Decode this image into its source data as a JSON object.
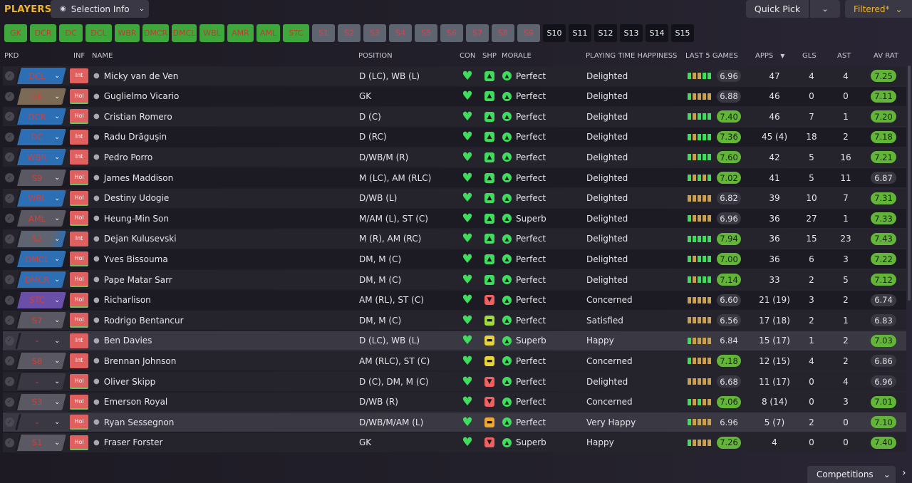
{
  "header": {
    "title": "PLAYERS",
    "selection_info": "Selection Info",
    "quick_pick": "Quick Pick",
    "filtered": "Filtered*"
  },
  "chips": [
    {
      "label": "GK",
      "style": "g",
      "w": 32
    },
    {
      "label": "DCR",
      "style": "g",
      "w": 37
    },
    {
      "label": "DC",
      "style": "g",
      "w": 33
    },
    {
      "label": "DCL",
      "style": "g",
      "w": 37
    },
    {
      "label": "WBR",
      "style": "g",
      "w": 35
    },
    {
      "label": "DMCR",
      "style": "g",
      "w": 37
    },
    {
      "label": "DMCL",
      "style": "g",
      "w": 35
    },
    {
      "label": "WBL",
      "style": "g",
      "w": 35
    },
    {
      "label": "AMR",
      "style": "g",
      "w": 37
    },
    {
      "label": "AML",
      "style": "g",
      "w": 33
    },
    {
      "label": "STC",
      "style": "g",
      "w": 37
    },
    {
      "label": "S1",
      "style": "s",
      "w": 32
    },
    {
      "label": "S2",
      "style": "s",
      "w": 32
    },
    {
      "label": "S3",
      "style": "s",
      "w": 32
    },
    {
      "label": "S4",
      "style": "s",
      "w": 32
    },
    {
      "label": "S5",
      "style": "s",
      "w": 32
    },
    {
      "label": "S6",
      "style": "s",
      "w": 32
    },
    {
      "label": "S7",
      "style": "s",
      "w": 32
    },
    {
      "label": "S8",
      "style": "s",
      "w": 32
    },
    {
      "label": "S9",
      "style": "s",
      "w": 32
    },
    {
      "label": "S10",
      "style": "d",
      "w": 32
    },
    {
      "label": "S11",
      "style": "d",
      "w": 32
    },
    {
      "label": "S12",
      "style": "d",
      "w": 32
    },
    {
      "label": "S13",
      "style": "d",
      "w": 32
    },
    {
      "label": "S14",
      "style": "d",
      "w": 32
    },
    {
      "label": "S15",
      "style": "d",
      "w": 32
    }
  ],
  "columns": {
    "pkd": "PKD",
    "inf": "INF",
    "name": "NAME",
    "position": "POSITION",
    "con": "CON",
    "shp": "SHP",
    "morale": "MORALE",
    "pth": "PLAYING TIME HAPPINESS",
    "last5": "LAST 5 GAMES",
    "apps": "APPS",
    "gls": "GLS",
    "ast": "AST",
    "avrat": "AV RAT"
  },
  "colors": {
    "accent": "#f0b429",
    "chip_green": "#3fa83c",
    "good": "#3fdc5e",
    "bad": "#d2403a"
  },
  "players": [
    {
      "pos": "DCL",
      "posStyle": "blue",
      "inf": "Int",
      "name": "Micky van de Ven",
      "position": "D (LC), WB (L)",
      "shp": "green",
      "morale": "Perfect",
      "pth": "Delighted",
      "bars": "gttgg",
      "last5rating": "6.96",
      "l5green": false,
      "apps": "47",
      "gls": "4",
      "ast": "4",
      "avrat": "7.25",
      "avgreen": true
    },
    {
      "pos": "GK",
      "posStyle": "brown",
      "inf": "Hol",
      "name": "Guglielmo Vicario",
      "position": "GK",
      "shp": "green",
      "morale": "Perfect",
      "pth": "Delighted",
      "bars": "gtttt",
      "last5rating": "6.88",
      "l5green": false,
      "apps": "46",
      "gls": "0",
      "ast": "0",
      "avrat": "7.11",
      "avgreen": true
    },
    {
      "pos": "DCR",
      "posStyle": "blue",
      "inf": "Hol",
      "name": "Cristian Romero",
      "position": "D (C)",
      "shp": "green",
      "morale": "Perfect",
      "pth": "Delighted",
      "bars": "gtggg",
      "last5rating": "7.40",
      "l5green": true,
      "apps": "46",
      "gls": "7",
      "ast": "1",
      "avrat": "7.20",
      "avgreen": true
    },
    {
      "pos": "DC",
      "posStyle": "blue",
      "inf": "Int",
      "name": "Radu Drăgușin",
      "position": "D (RC)",
      "shp": "green",
      "morale": "Perfect",
      "pth": "Delighted",
      "bars": "gtggg",
      "last5rating": "7.36",
      "l5green": true,
      "apps": "45 (4)",
      "gls": "18",
      "ast": "2",
      "avrat": "7.18",
      "avgreen": true
    },
    {
      "pos": "WBR",
      "posStyle": "blue",
      "inf": "Int",
      "name": "Pedro Porro",
      "position": "D/WB/M (R)",
      "shp": "green",
      "morale": "Perfect",
      "pth": "Delighted",
      "bars": "gtggg",
      "last5rating": "7.60",
      "l5green": true,
      "apps": "42",
      "gls": "5",
      "ast": "16",
      "avrat": "7.21",
      "avgreen": true
    },
    {
      "pos": "S9",
      "posStyle": "grey",
      "inf": "Hol",
      "name": "James Maddison",
      "position": "M (LC), AM (RLC)",
      "shp": "green",
      "morale": "Perfect",
      "pth": "Delighted",
      "bars": "gtgtg",
      "last5rating": "7.02",
      "l5green": true,
      "apps": "41",
      "gls": "5",
      "ast": "11",
      "avrat": "6.87",
      "avgreen": false
    },
    {
      "pos": "WBL",
      "posStyle": "blue",
      "inf": "Hol",
      "name": "Destiny Udogie",
      "position": "D/WB (L)",
      "shp": "green",
      "morale": "Perfect",
      "pth": "Delighted",
      "bars": "ttttt",
      "last5rating": "6.82",
      "l5green": false,
      "apps": "39",
      "gls": "10",
      "ast": "7",
      "avrat": "7.31",
      "avgreen": true
    },
    {
      "pos": "AML",
      "posStyle": "grey",
      "inf": "Hol",
      "name": "Heung-Min Son",
      "position": "M/AM (L), ST (C)",
      "shp": "green",
      "morale": "Superb",
      "pth": "Delighted",
      "bars": "gtttt",
      "last5rating": "6.96",
      "l5green": false,
      "apps": "36",
      "gls": "27",
      "ast": "1",
      "avrat": "7.33",
      "avgreen": true
    },
    {
      "pos": "S2",
      "posStyle": "gb",
      "inf": "Int",
      "name": "Dejan Kulusevski",
      "position": "M (R), AM (RC)",
      "shp": "green",
      "morale": "Perfect",
      "pth": "Delighted",
      "bars": "ggggg",
      "last5rating": "7.94",
      "l5green": true,
      "apps": "36",
      "gls": "15",
      "ast": "23",
      "avrat": "7.43",
      "avgreen": true
    },
    {
      "pos": "DMCL",
      "posStyle": "blue",
      "inf": "Hol",
      "name": "Yves Bissouma",
      "position": "DM, M (C)",
      "shp": "green",
      "morale": "Perfect",
      "pth": "Delighted",
      "bars": "gtggg",
      "last5rating": "7.00",
      "l5green": true,
      "apps": "36",
      "gls": "6",
      "ast": "3",
      "avrat": "7.22",
      "avgreen": true
    },
    {
      "pos": "DMCR",
      "posStyle": "blue",
      "inf": "Hol",
      "name": "Pape Matar Sarr",
      "position": "DM, M (C)",
      "shp": "green",
      "morale": "Perfect",
      "pth": "Delighted",
      "bars": "gtggg",
      "last5rating": "7.14",
      "l5green": true,
      "apps": "33",
      "gls": "2",
      "ast": "5",
      "avrat": "7.12",
      "avgreen": true
    },
    {
      "pos": "STC",
      "posStyle": "purple",
      "inf": "Hol",
      "name": "Richarlison",
      "position": "AM (RL), ST (C)",
      "shp": "red",
      "morale": "Perfect",
      "pth": "Concerned",
      "bars": "ttttt",
      "last5rating": "6.60",
      "l5green": false,
      "apps": "21 (19)",
      "gls": "3",
      "ast": "2",
      "avrat": "6.74",
      "avgreen": false
    },
    {
      "pos": "S7",
      "posStyle": "grey",
      "inf": "Hol",
      "name": "Rodrigo Bentancur",
      "position": "DM, M (C)",
      "shp": "lime",
      "morale": "Perfect",
      "pth": "Satisfied",
      "bars": "ttttt",
      "last5rating": "6.56",
      "l5green": false,
      "apps": "17 (18)",
      "gls": "2",
      "ast": "1",
      "avrat": "6.83",
      "avgreen": false
    },
    {
      "pos": "-",
      "posStyle": "dark",
      "inf": "Int",
      "name": "Ben Davies",
      "position": "D (LC), WB (L)",
      "shp": "yellow",
      "morale": "Superb",
      "pth": "Happy",
      "bars": "gtttt",
      "last5rating": "6.84",
      "l5green": false,
      "apps": "15 (17)",
      "gls": "1",
      "ast": "2",
      "avrat": "7.03",
      "avgreen": true
    },
    {
      "pos": "S8",
      "posStyle": "grey",
      "inf": "Int",
      "name": "Brennan Johnson",
      "position": "AM (RLC), ST (C)",
      "shp": "yellow",
      "morale": "Perfect",
      "pth": "Concerned",
      "bars": "gtttt",
      "last5rating": "7.18",
      "l5green": true,
      "apps": "12 (15)",
      "gls": "4",
      "ast": "2",
      "avrat": "6.86",
      "avgreen": false
    },
    {
      "pos": "-",
      "posStyle": "dark",
      "inf": "Hol",
      "name": "Oliver Skipp",
      "position": "D (C), DM, M (C)",
      "shp": "red",
      "morale": "Perfect",
      "pth": "Delighted",
      "bars": "ttttt",
      "last5rating": "6.68",
      "l5green": false,
      "apps": "11 (17)",
      "gls": "0",
      "ast": "4",
      "avrat": "6.96",
      "avgreen": false
    },
    {
      "pos": "S3",
      "posStyle": "grey",
      "inf": "Hol",
      "name": "Emerson Royal",
      "position": "D/WB (R)",
      "shp": "red",
      "morale": "Perfect",
      "pth": "Concerned",
      "bars": "gtgtt",
      "last5rating": "7.06",
      "l5green": true,
      "apps": "8 (14)",
      "gls": "0",
      "ast": "3",
      "avrat": "7.01",
      "avgreen": true
    },
    {
      "pos": "-",
      "posStyle": "dark",
      "inf": "Hol",
      "name": "Ryan Sessegnon",
      "position": "D/WB/M/AM (L)",
      "shp": "orange",
      "morale": "Perfect",
      "pth": "Very Happy",
      "bars": "gtttt",
      "last5rating": "6.96",
      "l5green": false,
      "apps": "5 (7)",
      "gls": "2",
      "ast": "0",
      "avrat": "7.10",
      "avgreen": true
    },
    {
      "pos": "S1",
      "posStyle": "grey",
      "inf": "Hol",
      "name": "Fraser Forster",
      "position": "GK",
      "shp": "red",
      "morale": "Superb",
      "pth": "Happy",
      "bars": "gtttt",
      "last5rating": "7.26",
      "l5green": true,
      "apps": "4",
      "gls": "0",
      "ast": "0",
      "avrat": "7.40",
      "avgreen": true
    }
  ],
  "footer": {
    "competitions": "Competitions"
  }
}
